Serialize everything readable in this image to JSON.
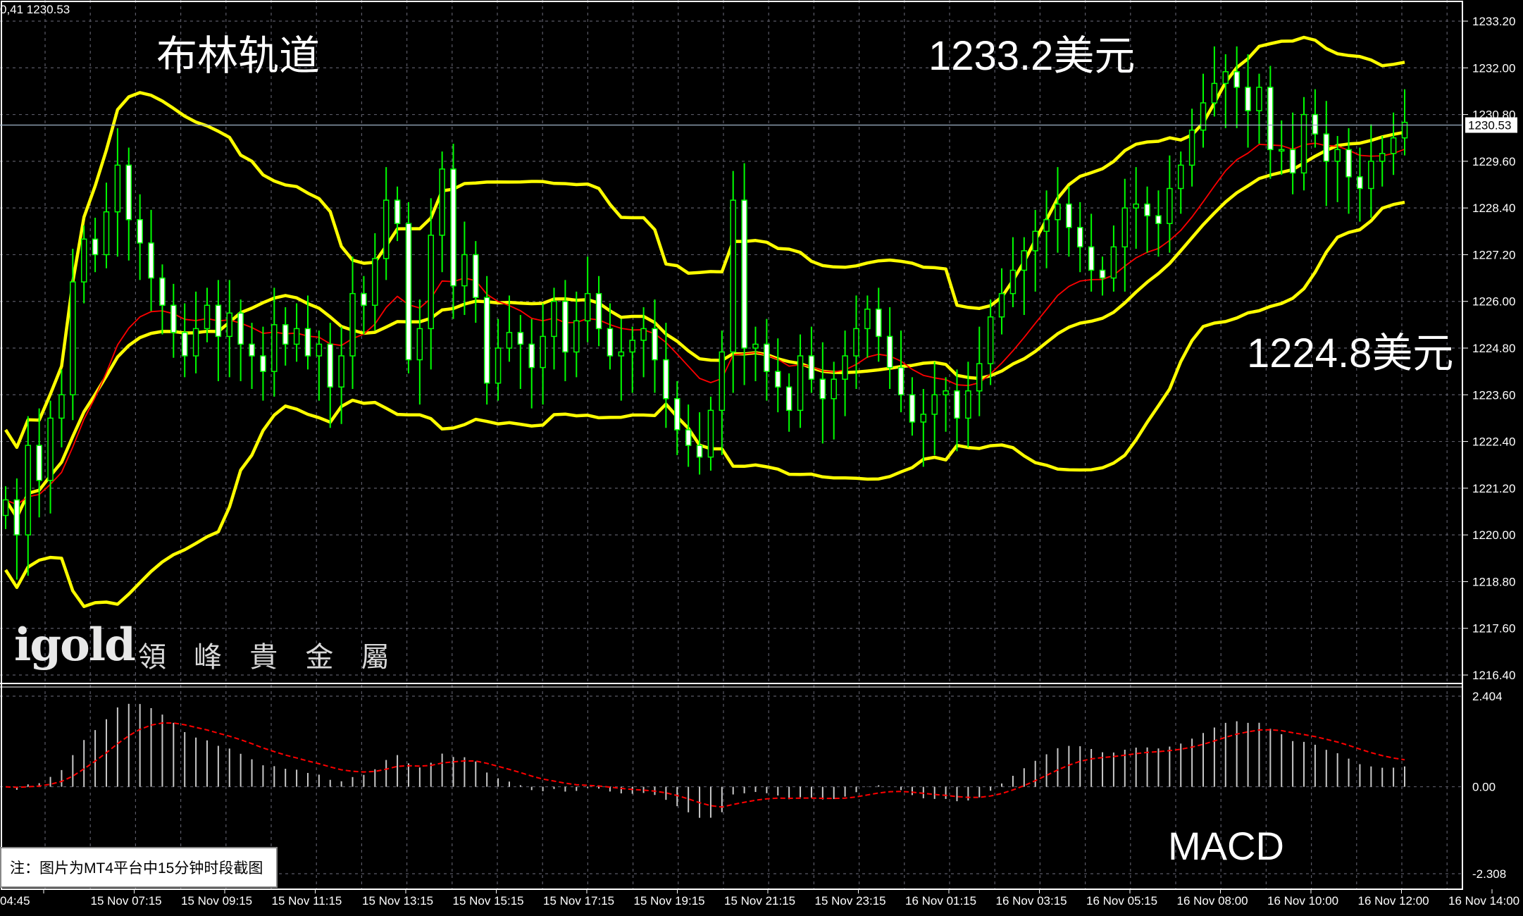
{
  "header": {
    "text": "0,41 1230.53"
  },
  "annotations": {
    "title": "布林轨道",
    "upper": "1233.2美元",
    "lower": "1224.8美元",
    "macd": "MACD"
  },
  "watermark": {
    "logo": "igold",
    "chinese": "領 峰 貴 金 屬"
  },
  "note": "注：图片为MT4平台中15分钟时段截图",
  "colors": {
    "background": "#000000",
    "grid": "#5a5a66",
    "bull_candle": "#00ff00",
    "bear_candle": "#ffffff",
    "bollinger": "#ffff00",
    "ma": "#ff0000",
    "macd_hist": "#c8c8c8",
    "signal": "#ff0000",
    "price_line": "#a0b4c8"
  },
  "chart_data": {
    "type": "candlestick",
    "price_axis": {
      "ticks": [
        "1233.20",
        "1232.00",
        "1230.80",
        "1229.60",
        "1228.40",
        "1227.20",
        "1226.00",
        "1224.80",
        "1223.60",
        "1222.40",
        "1221.20",
        "1220.00",
        "1218.80",
        "1217.60",
        "1216.40"
      ],
      "current": "1230.53",
      "range": [
        1216.4,
        1233.2
      ]
    },
    "macd_axis": {
      "ticks": [
        "2.404",
        "0.00",
        "-2.308"
      ],
      "range": [
        -2.308,
        2.404
      ]
    },
    "time_labels": [
      "04:45",
      "15 Nov 07:15",
      "15 Nov 09:15",
      "15 Nov 11:15",
      "15 Nov 13:15",
      "15 Nov 15:15",
      "15 Nov 17:15",
      "15 Nov 19:15",
      "15 Nov 21:15",
      "15 Nov 23:15",
      "16 Nov 01:15",
      "16 Nov 03:15",
      "16 Nov 05:15",
      "16 Nov 08:00",
      "16 Nov 10:00",
      "16 Nov 12:00",
      "16 Nov 14:00"
    ],
    "close": [
      1220.9,
      1220.0,
      1222.3,
      1221.4,
      1223.0,
      1223.6,
      1226.5,
      1227.6,
      1227.2,
      1228.3,
      1229.5,
      1228.1,
      1227.5,
      1226.6,
      1225.9,
      1225.2,
      1224.6,
      1225.3,
      1225.9,
      1225.1,
      1225.7,
      1224.9,
      1224.6,
      1224.2,
      1225.4,
      1224.9,
      1225.3,
      1224.6,
      1224.9,
      1223.8,
      1224.6,
      1226.2,
      1225.9,
      1227.1,
      1228.6,
      1228.0,
      1224.5,
      1225.3,
      1227.7,
      1229.4,
      1226.4,
      1227.2,
      1226.1,
      1223.9,
      1224.8,
      1225.2,
      1224.9,
      1224.3,
      1225.1,
      1226.0,
      1224.7,
      1225.5,
      1226.2,
      1225.3,
      1224.6,
      1224.7,
      1225.0,
      1225.3,
      1224.5,
      1223.5,
      1222.7,
      1222.3,
      1222.0,
      1223.2,
      1224.7,
      1228.6,
      1224.8,
      1224.9,
      1224.2,
      1223.8,
      1223.2,
      1224.6,
      1224.0,
      1223.5,
      1224.0,
      1224.6,
      1225.3,
      1225.8,
      1225.1,
      1224.3,
      1223.6,
      1222.9,
      1223.1,
      1223.6,
      1223.7,
      1223.0,
      1223.7,
      1224.4,
      1225.6,
      1226.2,
      1226.8,
      1227.3,
      1227.8,
      1228.1,
      1228.5,
      1227.9,
      1227.4,
      1226.8,
      1226.6,
      1227.4,
      1228.4,
      1228.5,
      1228.2,
      1228.0,
      1228.9,
      1229.5,
      1230.4,
      1231.1,
      1231.6,
      1231.9,
      1231.5,
      1230.9,
      1231.5,
      1229.9,
      1229.9,
      1229.3,
      1230.8,
      1230.3,
      1229.6,
      1229.9,
      1229.2,
      1228.9,
      1229.6,
      1229.8,
      1230.2,
      1230.6
    ]
  }
}
